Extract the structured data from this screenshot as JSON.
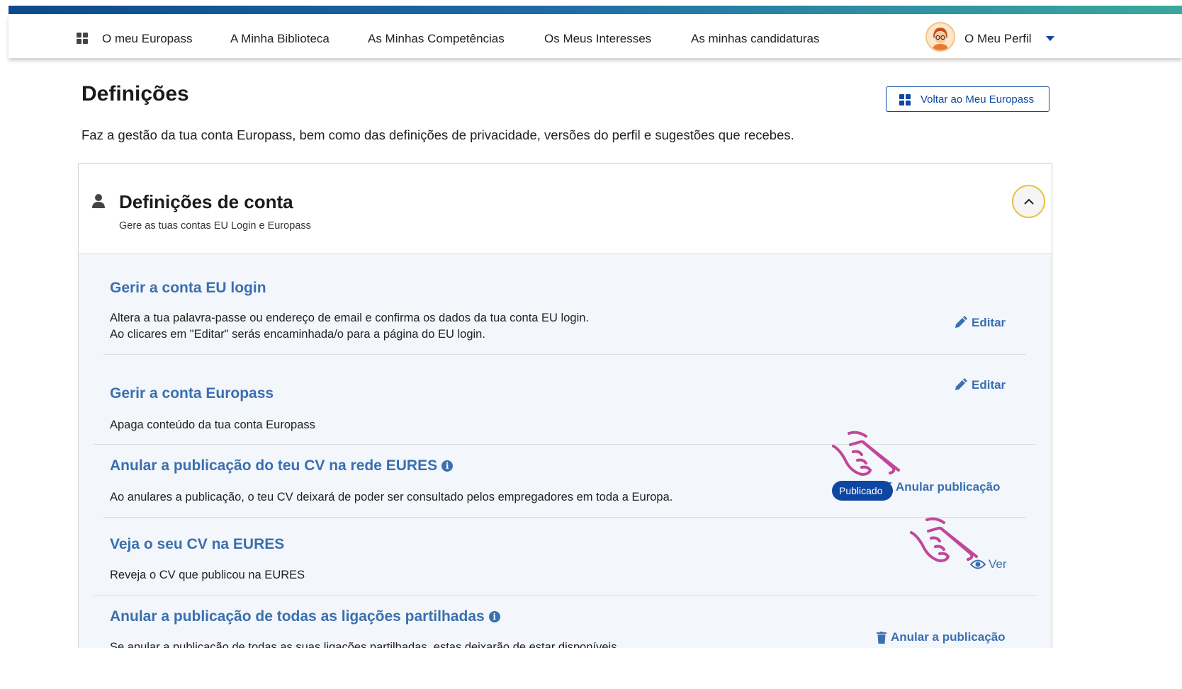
{
  "nav": {
    "items": [
      "O meu Europass",
      "A Minha Biblioteca",
      "As Minhas Competências",
      "Os Meus Interesses",
      "As minhas candidaturas"
    ],
    "profile_label": "O Meu Perfil"
  },
  "header": {
    "title": "Definições",
    "back_button": "Voltar ao Meu Europass",
    "description": "Faz a gestão da tua conta Europass, bem como das definições de privacidade, versões do perfil e sugestões que recebes."
  },
  "section": {
    "title": "Definições de conta",
    "subtitle": "Gere as tuas contas EU Login e Europass"
  },
  "rows": [
    {
      "title": "Gerir a conta EU login",
      "lines": [
        "Altera a tua palavra-passe ou endereço de email e confirma os dados da tua conta EU login.",
        "Ao clicares em \"Editar\" serás encaminhada/o para a página do EU login."
      ],
      "action": "Editar"
    },
    {
      "title": "Gerir a conta Europass",
      "lines": [
        "Apaga conteúdo da tua conta Europass"
      ],
      "action": "Editar"
    },
    {
      "title": "Anular a publicação do teu CV na rede EURES",
      "lines": [
        "Ao anulares a publicação, o teu CV deixará de poder ser consultado pelos empregadores em toda a Europa."
      ],
      "action": "Anular publicação",
      "badge": "Publicado"
    },
    {
      "title": "Veja o seu CV na EURES",
      "lines": [
        "Reveja o CV que publicou na EURES"
      ],
      "action": "Ver"
    },
    {
      "title": "Anular a publicação de todas as ligações partilhadas",
      "lines": [
        "Se anular a publicação de todas as suas ligações partilhadas, estas deixarão de estar disponíveis"
      ],
      "action": "Anular a publicação"
    }
  ],
  "colors": {
    "brand_blue": "#0e47a1",
    "link_blue": "#3a6fb0",
    "focus_ring": "#e9c13c",
    "pointer_annotation": "#c0479a"
  },
  "icons": [
    "grid-icon",
    "avatar",
    "chevron-down-icon",
    "person-icon",
    "chevron-up-icon",
    "pencil-icon",
    "info-icon",
    "trash-icon",
    "eye-icon",
    "pointer-hand-icon"
  ]
}
